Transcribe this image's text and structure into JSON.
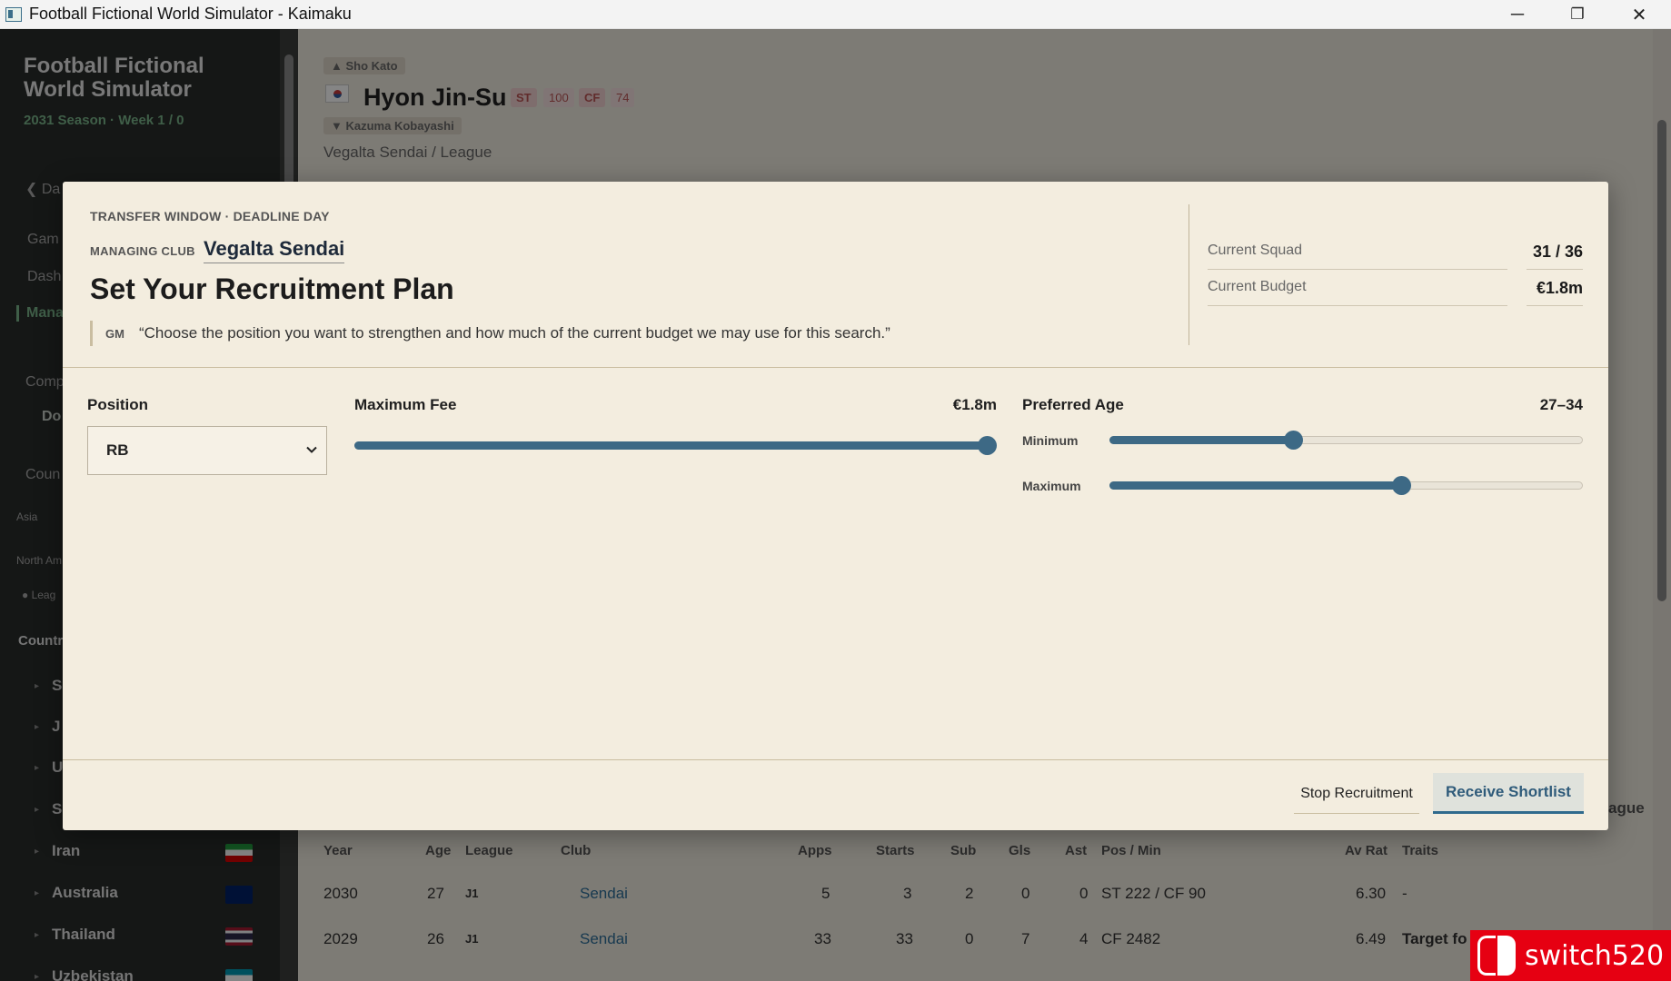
{
  "window": {
    "title": "Football Fictional World Simulator - Kaimaku",
    "minimize": "─",
    "restore": "❐",
    "close": "✕"
  },
  "sidebar": {
    "brand_line1": "Football Fictional",
    "brand_line2": "World Simulator",
    "season": "2031 Season · Week 1 / 0",
    "fragments": [
      "❮ Da",
      "Gam",
      "Dash",
      "Mana",
      "Comp",
      "Do",
      "Coun",
      "Asia",
      "North Am",
      "● Leag",
      "Countr"
    ],
    "countries": [
      {
        "name": "S",
        "flag": "#ffffff"
      },
      {
        "name": "J",
        "flag": "#ffffff"
      },
      {
        "name": "U",
        "flag": "#ffffff"
      },
      {
        "name": "S",
        "flag": "#ffffff"
      },
      {
        "name": "Iran",
        "flag_colors": [
          "#239f40",
          "#ffffff",
          "#da0000"
        ]
      },
      {
        "name": "Australia",
        "flag_colors": [
          "#012169",
          "#ffffff",
          "#e4002b"
        ]
      },
      {
        "name": "Thailand",
        "flag_colors": [
          "#a51931",
          "#f4f5f8",
          "#2d2a4a"
        ]
      },
      {
        "name": "Uzbekistan",
        "flag_colors": [
          "#0099b5",
          "#ffffff",
          "#1eb53a"
        ]
      }
    ]
  },
  "background": {
    "prev_player": "▲ Sho Kato",
    "player_name": "Hyon Jin-Su",
    "positions": [
      {
        "pos": "ST",
        "val": "100"
      },
      {
        "pos": "CF",
        "val": "74"
      }
    ],
    "next_player": "▼ Kazuma Kobayashi",
    "club_league": "Vegalta Sendai / League",
    "right_fragment": "ague",
    "table_headers": [
      "Year",
      "Age",
      "League",
      "Club",
      "Apps",
      "Starts",
      "Sub",
      "Gls",
      "Ast",
      "Pos / Min",
      "Av Rat",
      "Traits"
    ],
    "rows": [
      {
        "year": "2030",
        "age": "27",
        "league": "J1",
        "club": "Sendai",
        "apps": "5",
        "starts": "3",
        "sub": "2",
        "gls": "0",
        "ast": "0",
        "pos_min": "ST 222 / CF 90",
        "av_rat": "6.30",
        "traits": "-"
      },
      {
        "year": "2029",
        "age": "26",
        "league": "J1",
        "club": "Sendai",
        "apps": "33",
        "starts": "33",
        "sub": "0",
        "gls": "7",
        "ast": "4",
        "pos_min": "CF 2482",
        "av_rat": "6.49",
        "traits": "Target fo"
      }
    ]
  },
  "modal": {
    "eyebrow": "TRANSFER WINDOW · DEADLINE DAY",
    "club_label": "MANAGING CLUB",
    "club_name": "Vegalta Sendai",
    "title": "Set Your Recruitment Plan",
    "gm_label": "GM",
    "gm_quote": "“Choose the position you want to strengthen and how much of the current budget we may use for this search.”",
    "stats": [
      {
        "label": "Current Squad",
        "value": "31 / 36"
      },
      {
        "label": "Current Budget",
        "value": "€1.8m"
      }
    ],
    "position": {
      "label": "Position",
      "selected": "RB"
    },
    "max_fee": {
      "label": "Maximum Fee",
      "value": "€1.8m",
      "fraction": 1.0
    },
    "preferred_age": {
      "label": "Preferred Age",
      "value": "27–34",
      "min_label": "Minimum",
      "max_label": "Maximum",
      "min_fraction": 0.387,
      "max_fraction": 0.617
    },
    "buttons": {
      "stop": "Stop Recruitment",
      "receive": "Receive Shortlist"
    }
  },
  "watermark": "switch520",
  "colors": {
    "accent": "#3d6985",
    "modal_bg": "#f3eddf",
    "sidebar_bg": "#2a2d2b",
    "watermark_red": "#e60012"
  }
}
